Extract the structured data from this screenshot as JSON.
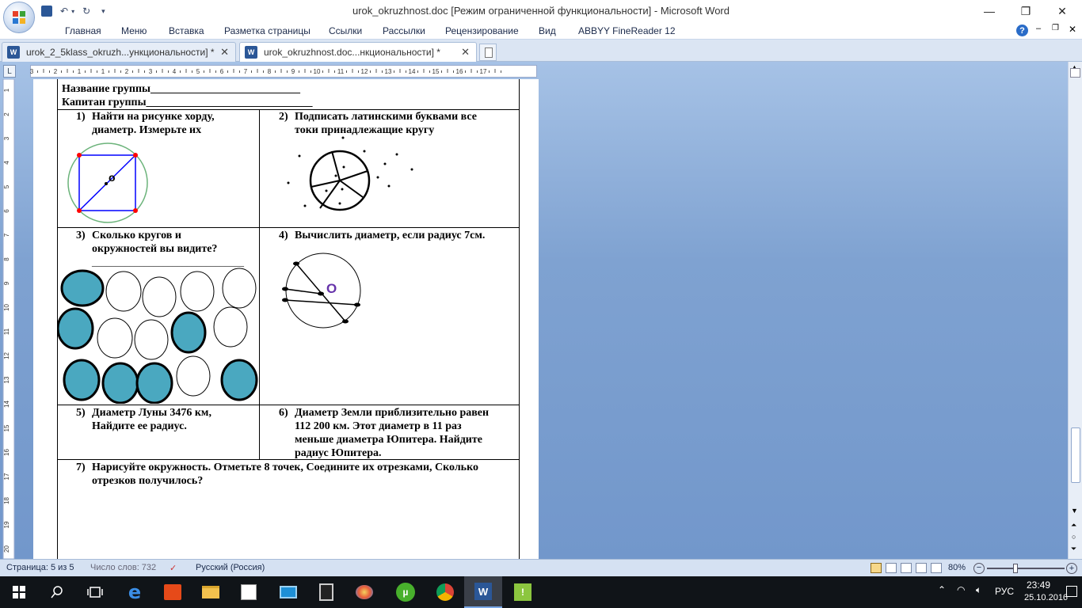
{
  "window": {
    "title": "urok_okruzhnost.doc [Режим ограниченной функциональности] - Microsoft Word"
  },
  "ribbon": {
    "tabs": [
      "Главная",
      "Меню",
      "Вставка",
      "Разметка страницы",
      "Ссылки",
      "Рассылки",
      "Рецензирование",
      "Вид",
      "ABBYY FineReader 12"
    ]
  },
  "doctabs": [
    {
      "label": "urok_2_5klass_okruzh...ункциональности]  *"
    },
    {
      "label": "urok_okruzhnost.doc...нкциональности]  *"
    }
  ],
  "ruler": {
    "marks": [
      "3",
      "2",
      "1",
      "1",
      "2",
      "3",
      "4",
      "5",
      "6",
      "7",
      "8",
      "9",
      "10",
      "11",
      "12",
      "13",
      "14",
      "15",
      "16",
      "17"
    ],
    "vmarks": [
      "1",
      "2",
      "3",
      "4",
      "5",
      "6",
      "7",
      "8",
      "9",
      "10",
      "11",
      "12",
      "13",
      "14",
      "15",
      "16",
      "17",
      "18",
      "19",
      "20"
    ]
  },
  "document": {
    "header_line1": "Название группы___________________________",
    "header_line2": "Капитан группы______________________________",
    "task1": {
      "num": "1)",
      "text_line1": "Найти на рисунке хорду,",
      "text_line2": "диаметр. Измерьте их",
      "center_label": "o"
    },
    "task2": {
      "num": "2)",
      "text_line1": "Подписать латинскими буквами все",
      "text_line2": "токи принадлежащие кругу"
    },
    "task3": {
      "num": "3)",
      "text_line1": "Сколько кругов и",
      "text_line2": "окружностей вы видите?",
      "text_line3": "________________________________"
    },
    "task4": {
      "num": "4)",
      "text_line1": "Вычислить диаметр, если радиус 7см.",
      "center_label": "O"
    },
    "task5": {
      "num": "5)",
      "text_line1": "Диаметр Луны 3476 км,",
      "text_line2": "Найдите ее радиус."
    },
    "task6": {
      "num": "6)",
      "text_line1": "Диаметр Земли приблизительно равен",
      "text_line2": "112 200 км. Этот диаметр в 11 раз",
      "text_line3": "меньше диаметра Юпитера. Найдите",
      "text_line4": "радиус Юпитера."
    },
    "task7": {
      "num": "7)",
      "text_line1": "Нарисуйте окружность. Отметьте 8 точек, Соедините их отрезками, Сколько",
      "text_line2": "отрезков получилось?"
    }
  },
  "statusbar": {
    "page": "Страница: 5 из 5",
    "words": "Число слов: 732",
    "language": "Русский (Россия)",
    "zoom": "80%"
  },
  "taskbar": {
    "icons": [
      "windows-start-icon",
      "search-icon",
      "task-view-icon",
      "edge-icon",
      "office-icon",
      "file-explorer-icon",
      "store-icon",
      "remote-desktop-icon",
      "calculator-icon",
      "paint-icon",
      "utorrent-icon",
      "chrome-icon",
      "word-icon",
      "app-icon"
    ],
    "language": "РУС",
    "time": "23:49",
    "date": "25.10.2016"
  },
  "colors": {
    "workspace": "#7fa2d1",
    "filled_circle": "#4aa8c0",
    "chord_line": "#0000ff",
    "chord_point": "#ff0000",
    "green_circle": "#6bb37a",
    "o_label": "#6633aa"
  }
}
